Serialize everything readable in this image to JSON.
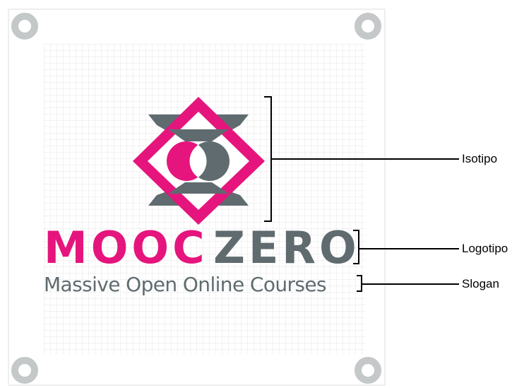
{
  "brand": {
    "word1": "MOOC",
    "word2": "ZERO",
    "slogan": "Massive Open Online Courses"
  },
  "annotations": {
    "isotipo": "Isotipo",
    "logotipo": "Logotipo",
    "slogan": "Slogan"
  },
  "colors": {
    "magenta": "#e5157d",
    "slate": "#5f6b6f",
    "grid": "#e6e6e6",
    "corner_ring": "#c4c8c9"
  },
  "icons": {
    "corners": "ring-icon",
    "isotipo": "diamond-eye-icon"
  }
}
